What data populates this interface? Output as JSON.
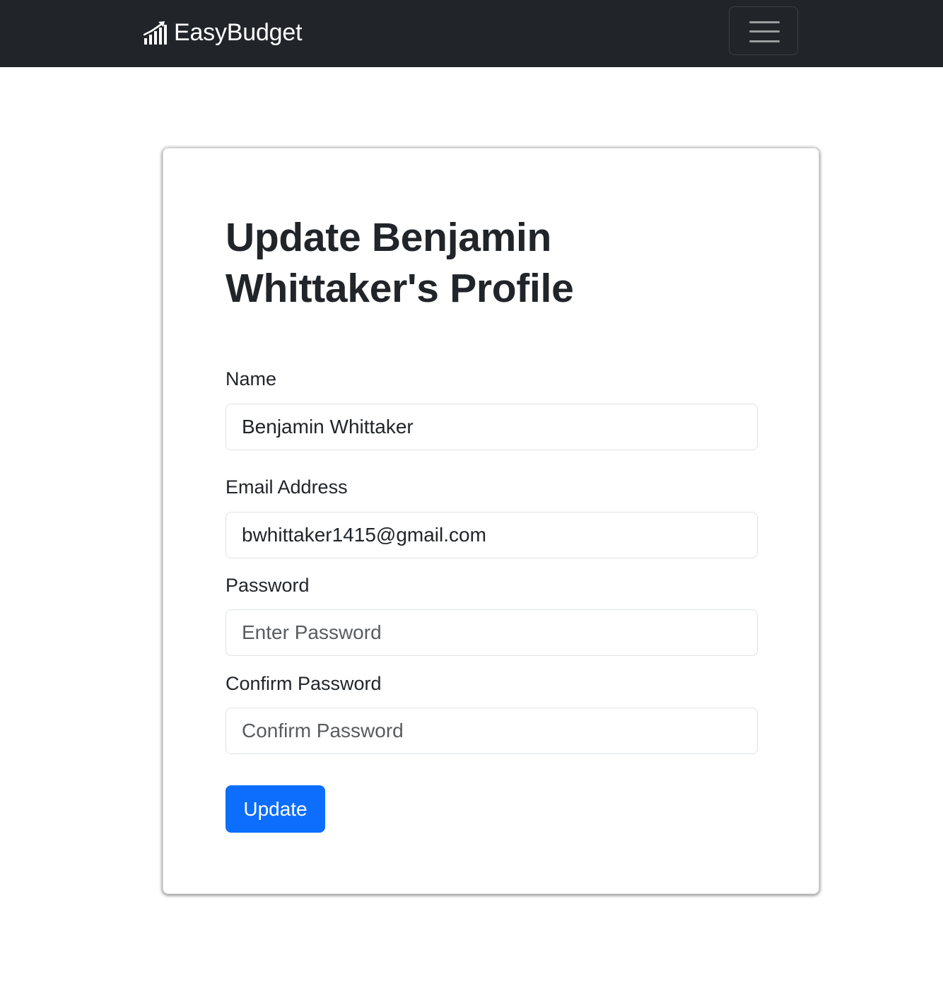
{
  "navbar": {
    "brand_label": "EasyBudget",
    "brand_icon": "bar-chart-growth-icon",
    "toggler_icon": "hamburger-menu-icon",
    "background_color": "#212529"
  },
  "form": {
    "title": "Update Benjamin Whittaker's Profile",
    "name": {
      "label": "Name",
      "value": "Benjamin Whittaker"
    },
    "email": {
      "label": "Email Address",
      "value": "bwhittaker1415@gmail.com"
    },
    "password": {
      "label": "Password",
      "placeholder": "Enter Password"
    },
    "confirm_password": {
      "label": "Confirm Password",
      "placeholder": "Confirm Password"
    },
    "submit_label": "Update",
    "accent_color": "#0d6efd"
  }
}
